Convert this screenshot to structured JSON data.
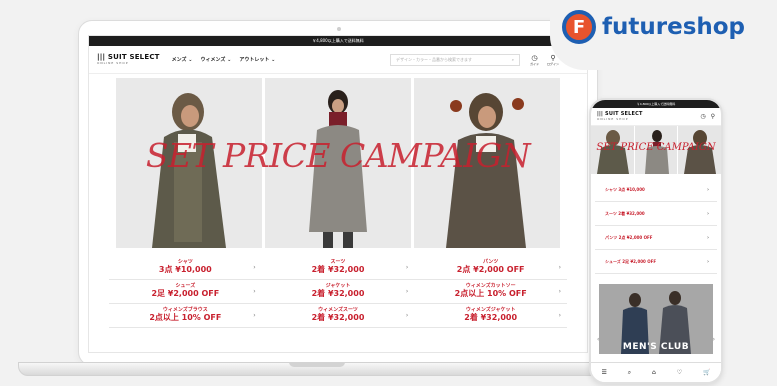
{
  "laptop": {
    "top_banner": "￥4,800以上購入で送料無料",
    "logo": {
      "main": "||| SUIT SELECT",
      "sub": "ONLINE SHOP"
    },
    "nav": [
      "メンズ ⌄",
      "ウィメンズ ⌄",
      "アウトレット ⌄"
    ],
    "search_placeholder": "デザイン・カラー・品番から検索できます",
    "header_icons": [
      {
        "icon": "clock-icon",
        "label": "ガイド"
      },
      {
        "icon": "user-icon",
        "label": "ログイン"
      },
      {
        "icon": "list-icon",
        "label": "お気に入"
      }
    ],
    "campaign_title": "SET PRICE CAMPAIGN",
    "grid": [
      {
        "title": "シャツ",
        "price": "3点 ¥10,000"
      },
      {
        "title": "スーツ",
        "price": "2着 ¥32,000"
      },
      {
        "title": "パンツ",
        "price": "2点 ¥2,000 OFF"
      },
      {
        "title": "シューズ",
        "price": "2足 ¥2,000 OFF"
      },
      {
        "title": "ジャケット",
        "price": "2着 ¥32,000"
      },
      {
        "title": "ウィメンズカットソー",
        "price": "2点以上 10% OFF"
      },
      {
        "title": "ウィメンズブラウス",
        "price": "2点以上 10% OFF"
      },
      {
        "title": "ウィメンズスーツ",
        "price": "2着 ¥32,000"
      },
      {
        "title": "ウィメンズジャケット",
        "price": "2着 ¥32,000"
      }
    ]
  },
  "brand": {
    "name": "futureshop",
    "mark": "F"
  },
  "phone": {
    "top_banner": "￥4,800以上購入で送料無料",
    "logo": {
      "main": "||| SUIT SELECT",
      "sub": "ONLINE SHOP"
    },
    "campaign_title": "SET PRICE CAMPAIGN",
    "rows": [
      "シャツ 3点 ¥10,000",
      "スーツ 2着 ¥32,000",
      "パンツ 2点 ¥2,000 OFF",
      "シューズ 2足 ¥2,000 OFF"
    ],
    "banner_text": "MEN'S CLUB",
    "bottom_nav": [
      "☰",
      "⌕",
      "⌂",
      "♡",
      "🛒"
    ]
  },
  "colors": {
    "accent_red": "#c8202e",
    "futureshop_blue": "#1e5fb2",
    "futureshop_orange": "#e8542d"
  }
}
